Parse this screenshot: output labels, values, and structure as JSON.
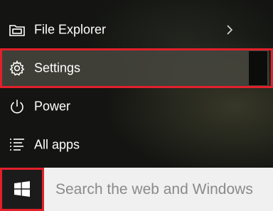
{
  "start_menu": {
    "items": [
      {
        "label": "File Explorer",
        "icon": "folder-icon",
        "has_submenu": true
      },
      {
        "label": "Settings",
        "icon": "gear-icon",
        "highlighted": true
      },
      {
        "label": "Power",
        "icon": "power-icon"
      },
      {
        "label": "All apps",
        "icon": "list-icon"
      }
    ]
  },
  "taskbar": {
    "start_icon": "windows-logo-icon",
    "search_placeholder": "Search the web and Windows"
  },
  "colors": {
    "highlight_border": "#e2202b",
    "menu_text": "#ffffff",
    "selected_row": "#46463e"
  }
}
